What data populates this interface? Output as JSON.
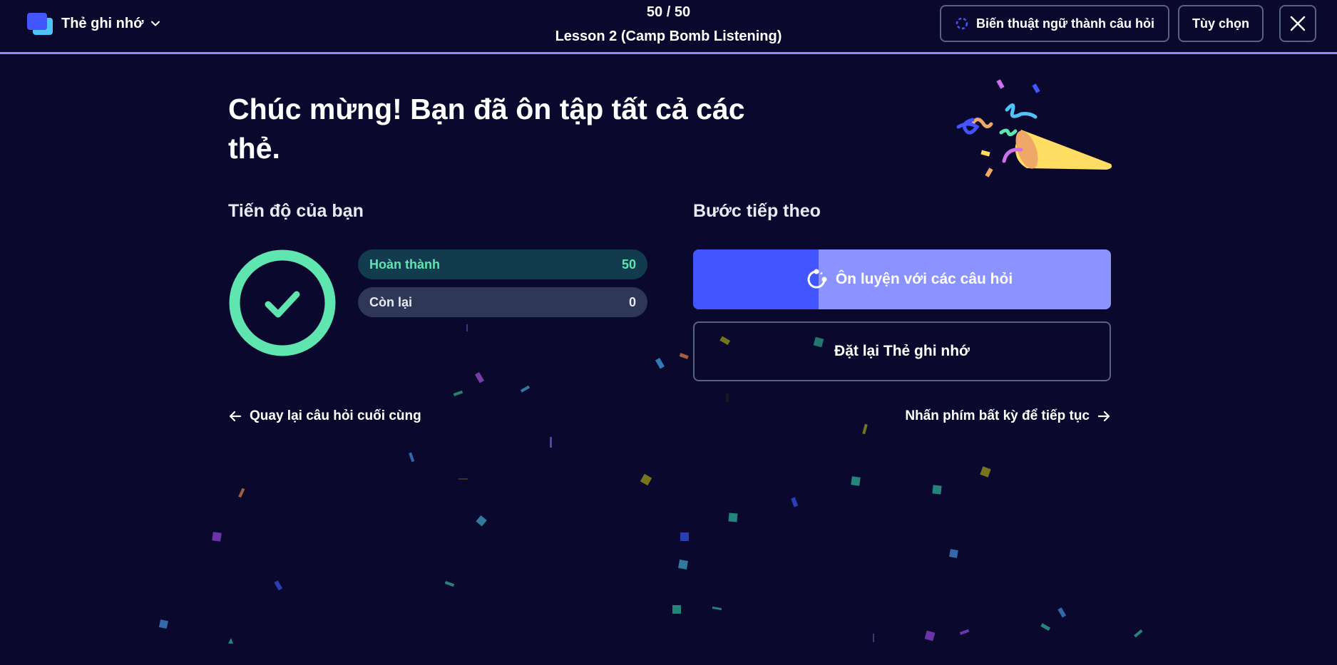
{
  "header": {
    "mode_label": "Thẻ ghi nhớ",
    "counter": "50 / 50",
    "set_title": "Lesson 2 (Camp Bomb Listening)",
    "convert_label": "Biến thuật ngữ thành câu hỏi",
    "options_label": "Tùy chọn"
  },
  "main": {
    "headline": "Chúc mừng! Bạn đã ôn tập tất cả các thẻ.",
    "progress": {
      "title": "Tiến độ của bạn",
      "completed_label": "Hoàn thành",
      "completed_count": "50",
      "remaining_label": "Còn lại",
      "remaining_count": "0"
    },
    "next_steps": {
      "title": "Bước tiếp theo",
      "practice_label": "Ôn luyện với các câu hỏi",
      "practice_fill_fraction": 0.3,
      "reset_label": "Đặt lại Thẻ ghi nhớ"
    },
    "back_link": "Quay lại câu hỏi cuối cùng",
    "continue_link": "Nhấn phím bất kỳ để tiếp tục"
  },
  "colors": {
    "background": "#0a092d",
    "accent": "#4255ff",
    "accent_light": "#8a93ff",
    "success": "#5ee5b0",
    "border": "#586380"
  }
}
